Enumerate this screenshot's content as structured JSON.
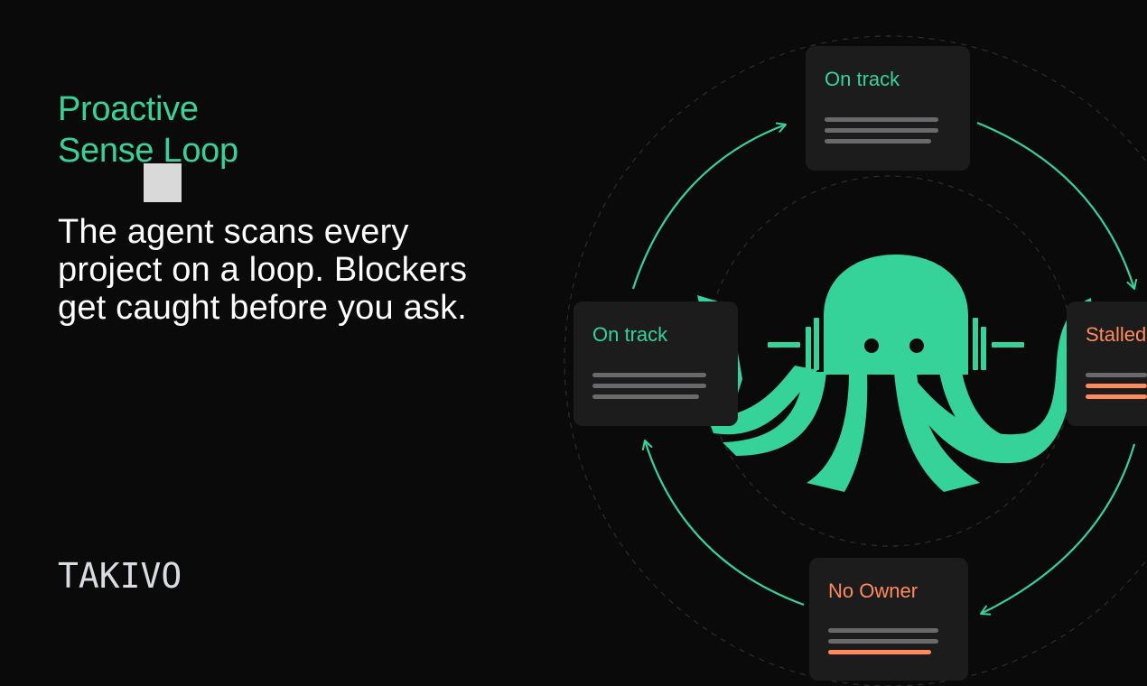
{
  "headline": {
    "line1": "Proactive",
    "line2": "Sense Loop"
  },
  "body": {
    "line1": "The agent scans every",
    "line2": "project on a loop.  Blockers",
    "line3": "get caught before you ask."
  },
  "brand": {
    "logo": "TAKIVO"
  },
  "cards": [
    {
      "id": "top",
      "title": "On track",
      "status": "ok"
    },
    {
      "id": "left",
      "title": "On track",
      "status": "ok"
    },
    {
      "id": "right",
      "title": "Stalled",
      "status": "warn"
    },
    {
      "id": "bottom",
      "title": "No Owner",
      "status": "warn"
    }
  ],
  "colors": {
    "accent": "#35d39a",
    "warning": "#ff8a5b",
    "background": "#0a0a0b",
    "card": "#1c1c1d"
  },
  "icons": {
    "mascot": "octopus-agent-icon"
  }
}
